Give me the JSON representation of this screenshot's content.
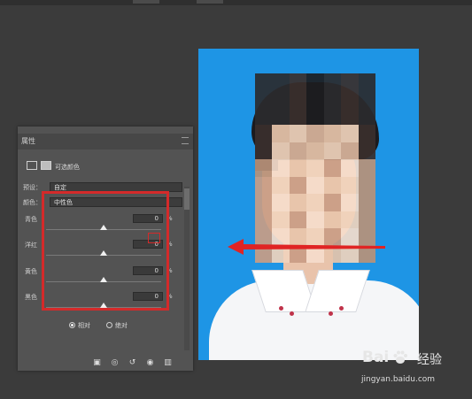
{
  "panel": {
    "tab_title": "属性",
    "adjustment_name": "可选颜色",
    "preset_label": "预设：",
    "preset_value": "自定",
    "colors_label": "颜色：",
    "colors_value": "中性色",
    "sliders": [
      {
        "label": "青色",
        "value": "0",
        "unit": "%",
        "level": 0.5
      },
      {
        "label": "洋红",
        "value": "0",
        "unit": "%",
        "level": 0.5
      },
      {
        "label": "黄色",
        "value": "0",
        "unit": "%",
        "level": 0.5
      },
      {
        "label": "黑色",
        "value": "0",
        "unit": "%",
        "level": 0.5
      }
    ],
    "radio_relative": "相对",
    "radio_absolute": "绝对",
    "selected_radio": "relative"
  },
  "watermark": {
    "logo": "Bai",
    "logo_cn": "经验",
    "url": "jingyan.baidu.com"
  },
  "colors": {
    "photo_background": "#1e95e5",
    "highlight": "#d42a2a",
    "panel": "#535353",
    "workspace": "#3b3b3b"
  },
  "icons": [
    "adjustment-layer-icon",
    "mask-icon",
    "clip-icon",
    "visibility-icon",
    "reset-icon",
    "delete-icon",
    "paw-icon"
  ]
}
